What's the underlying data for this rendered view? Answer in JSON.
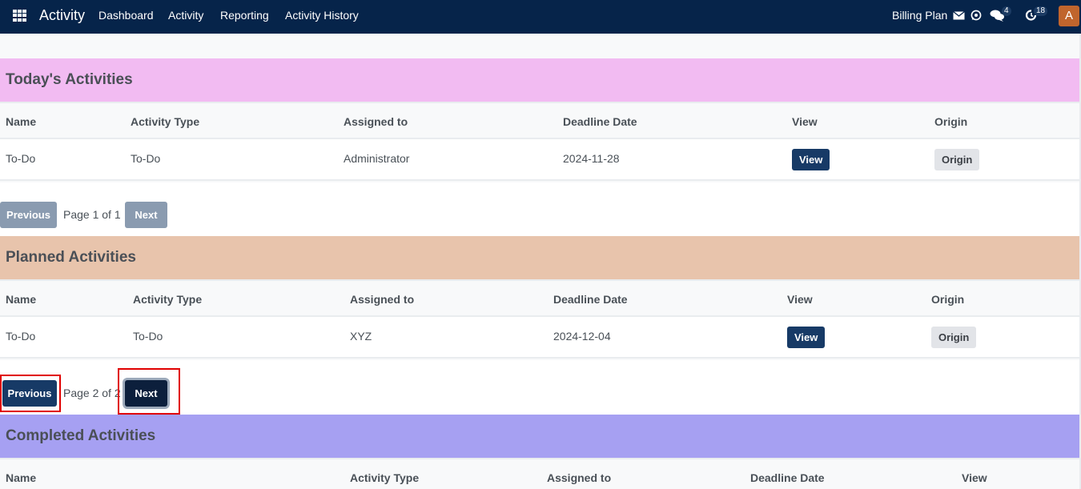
{
  "navbar": {
    "app_icon": "apps-grid-icon",
    "brand": "Activity",
    "menu": [
      "Dashboard",
      "Activity",
      "Reporting",
      "Activity History"
    ],
    "billing_label": "Billing Plan",
    "icons": [
      "envelope-icon",
      "whatsapp-icon",
      "chat-icon",
      "clock-icon"
    ],
    "chat_badge": "4",
    "activity_badge": "18",
    "avatar_initial": "A",
    "avatar_color": "#c0652d"
  },
  "sections": {
    "today": {
      "title": "Today's Activities",
      "color": "#f2bbf2",
      "columns": [
        "Name",
        "Activity Type",
        "Assigned to",
        "Deadline Date",
        "View",
        "Origin"
      ],
      "rows": [
        {
          "name": "To-Do",
          "type": "To-Do",
          "assigned": "Administrator",
          "deadline": "2024-11-28",
          "view": "View",
          "origin": "Origin"
        }
      ],
      "pager": {
        "prev": "Previous",
        "text": "Page 1 of 1",
        "next": "Next"
      }
    },
    "planned": {
      "title": "Planned Activities",
      "color": "#e8c4ac",
      "columns": [
        "Name",
        "Activity Type",
        "Assigned to",
        "Deadline Date",
        "View",
        "Origin"
      ],
      "rows": [
        {
          "name": "To-Do",
          "type": "To-Do",
          "assigned": "XYZ",
          "deadline": "2024-12-04",
          "view": "View",
          "origin": "Origin"
        }
      ],
      "pager": {
        "prev": "Previous",
        "text": "Page 2 of 2",
        "next": "Next"
      }
    },
    "completed": {
      "title": "Completed Activities",
      "color": "#a6a0f2",
      "columns": [
        "Name",
        "Activity Type",
        "Assigned to",
        "Deadline Date",
        "View"
      ]
    }
  }
}
